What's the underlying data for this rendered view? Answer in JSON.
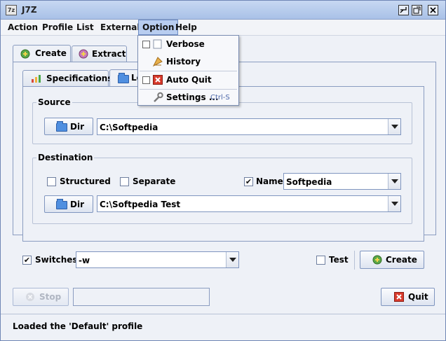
{
  "window": {
    "title": "J7Z",
    "app_icon": "7z"
  },
  "menubar": {
    "items": [
      "Action",
      "Profile",
      "List",
      "External",
      "Option",
      "Help"
    ]
  },
  "option_menu": {
    "items": [
      {
        "label": "Verbose",
        "icon": "checkbox-empty"
      },
      {
        "label": "History",
        "icon": "history-icon"
      },
      {
        "label": "Auto Quit",
        "icon": "checkbox-empty"
      },
      {
        "label": "Settings ...",
        "icon": "wrench-icon",
        "shortcut": "Ctrl-S"
      }
    ]
  },
  "outer_tabs": [
    {
      "label": "Create",
      "icon": "create-icon",
      "selected": true
    },
    {
      "label": "Extract",
      "icon": "extract-icon",
      "selected": false
    }
  ],
  "inner_tabs": [
    {
      "label": "Specifications",
      "icon": "bar-chart-icon",
      "selected": false
    },
    {
      "label": "Lo",
      "icon": "folder-icon",
      "selected": true
    }
  ],
  "source": {
    "title": "Source",
    "dir_button": "Dir",
    "path": "C:\\Softpedia"
  },
  "destination": {
    "title": "Destination",
    "structured": {
      "label": "Structured",
      "checked": false
    },
    "separate": {
      "label": "Separate",
      "checked": false
    },
    "name": {
      "label": "Name",
      "checked": true,
      "value": "Softpedia"
    },
    "dir_button": "Dir",
    "path": "C:\\Softpedia Test"
  },
  "switches": {
    "label": "Switches",
    "checked": true,
    "value": "-w"
  },
  "test": {
    "label": "Test",
    "checked": false
  },
  "create_button": "Create",
  "stop_button": "Stop",
  "quit_button": "Quit",
  "status": "Loaded the 'Default' profile",
  "colors": {
    "accent": "#6d8cc4",
    "menu_highlight": "#b8cdf0",
    "background": "#eef1f7"
  }
}
